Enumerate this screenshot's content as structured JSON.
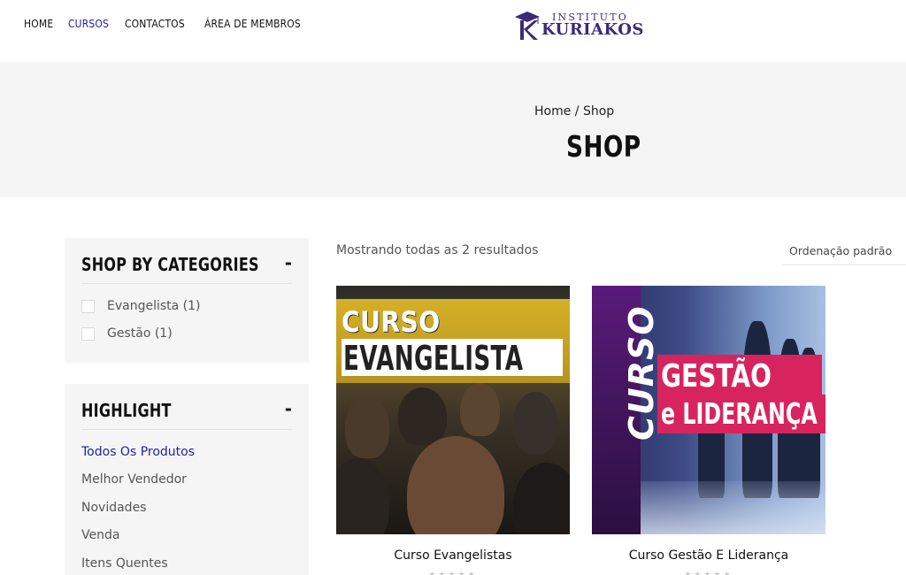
{
  "header": {
    "nav": [
      {
        "label": "HOME",
        "active": false
      },
      {
        "label": "CURSOS",
        "active": true
      },
      {
        "label": "CONTACTOS",
        "active": false
      },
      {
        "label": "ÁREA DE MEMBROS",
        "active": false
      }
    ],
    "logo": {
      "top": "INSTITUTO",
      "bottom": "KURIAKOS",
      "mark": "K"
    }
  },
  "hero": {
    "breadcrumb": "Home / Shop",
    "title": "SHOP"
  },
  "sidebar": {
    "categories": {
      "title": "SHOP BY CATEGORIES",
      "toggle": "-",
      "items": [
        {
          "label": "Evangelista (1)"
        },
        {
          "label": "Gestão (1)"
        }
      ]
    },
    "highlight": {
      "title": "HIGHLIGHT",
      "toggle": "-",
      "items": [
        {
          "label": "Todos Os Produtos",
          "active": true
        },
        {
          "label": "Melhor Vendedor",
          "active": false
        },
        {
          "label": "Novidades",
          "active": false
        },
        {
          "label": "Venda",
          "active": false
        },
        {
          "label": "Itens Quentes",
          "active": false
        }
      ]
    }
  },
  "results": {
    "count_text": "Mostrando todas as 2 resultados",
    "ordering": "Ordenação padrão"
  },
  "products": [
    {
      "name": "Curso Evangelistas",
      "image_line1": "CURSO",
      "image_line2": "EVANGELISTA",
      "stars": "★★★★★"
    },
    {
      "name": "Curso Gestão E Liderança",
      "image_line1": "CURSO",
      "image_line2": "GESTÃO",
      "image_line3": "e LIDERANÇA",
      "stars": "★★★★★"
    }
  ],
  "colors": {
    "accent": "#1f1fa8",
    "hero_bg": "#f5f5f5",
    "logo": "#3b2a7a",
    "tag": "#d8245e"
  }
}
